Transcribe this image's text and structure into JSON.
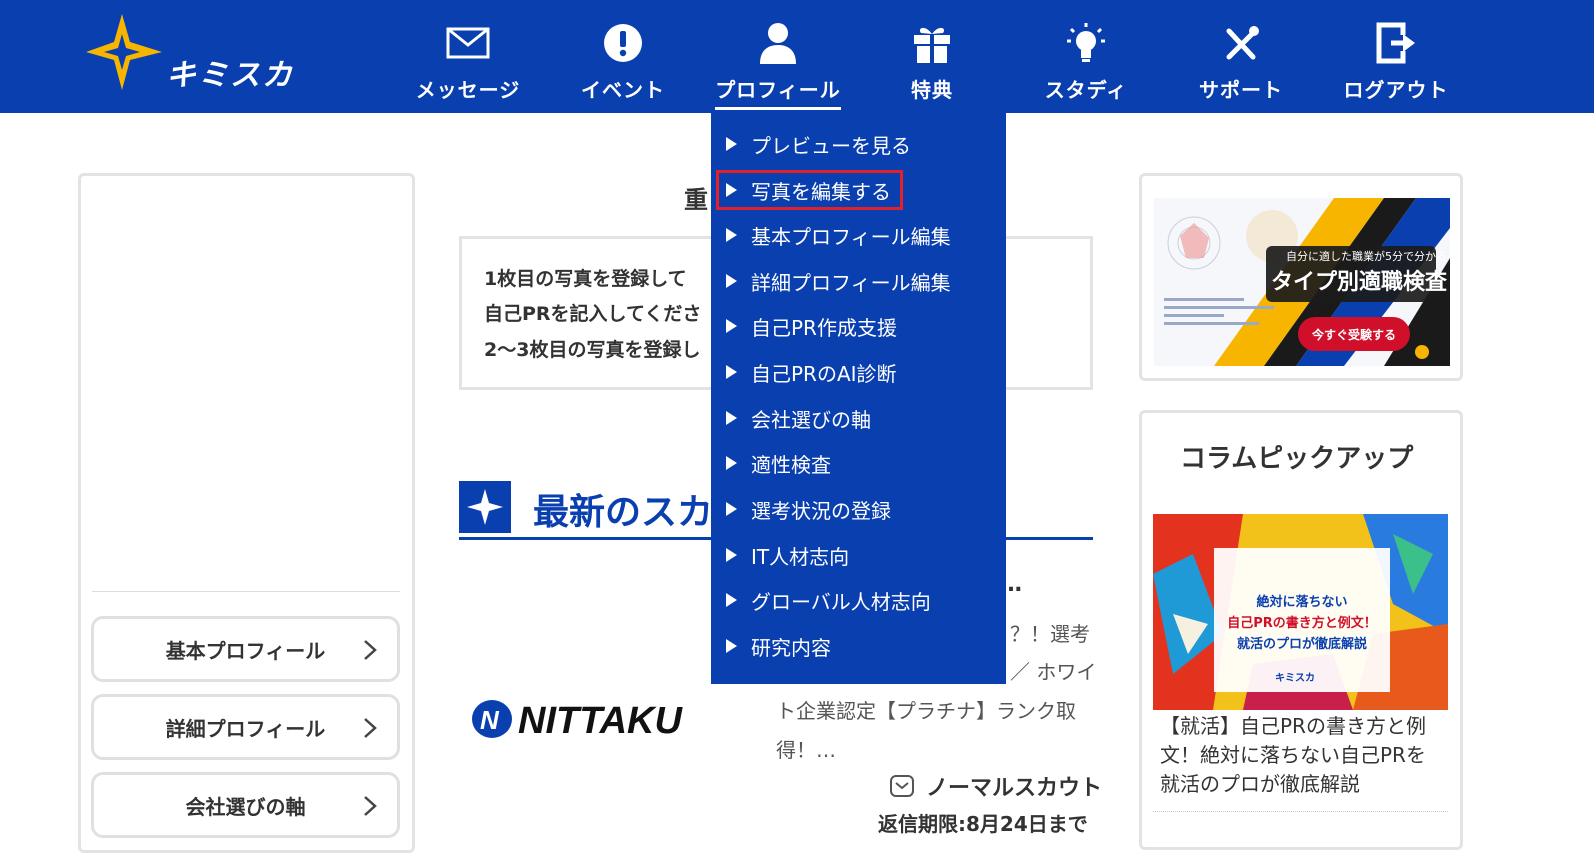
{
  "brand": {
    "name": "キミスカ"
  },
  "nav": [
    {
      "key": "message",
      "label": "メッセージ",
      "icon": "envelope-icon"
    },
    {
      "key": "event",
      "label": "イベント",
      "icon": "exclamation-icon"
    },
    {
      "key": "profile",
      "label": "プロフィール",
      "icon": "user-icon",
      "active": true
    },
    {
      "key": "benefit",
      "label": "特典",
      "icon": "gift-icon"
    },
    {
      "key": "study",
      "label": "スタディ",
      "icon": "lightbulb-icon"
    },
    {
      "key": "support",
      "label": "サポート",
      "icon": "tools-icon"
    },
    {
      "key": "logout",
      "label": "ログアウト",
      "icon": "logout-icon"
    }
  ],
  "dropdown": {
    "items": [
      "プレビューを見る",
      "写真を編集する",
      "基本プロフィール編集",
      "詳細プロフィール編集",
      "自己PR作成支援",
      "自己PRのAI診断",
      "会社選びの軸",
      "適性検査",
      "選考状況の登録",
      "IT人材志向",
      "グローバル人材志向",
      "研究内容"
    ],
    "highlighted_index": 1
  },
  "sidebar": {
    "buttons": [
      "基本プロフィール",
      "詳細プロフィール",
      "会社選びの軸"
    ]
  },
  "main": {
    "important_title": "重",
    "notice_lines": [
      "1枚目の写真を登録して",
      "自己PRを記入してくださ",
      "2〜3枚目の写真を登録し"
    ],
    "section_title": "最新のスカ",
    "scout": {
      "company_logo_text": "NITTAKU",
      "title_fragment": "…",
      "text_lines": [
        "？！選考",
        "／ ホワイ",
        "ト企業認定【プラチナ】ランク取",
        "得！…"
      ],
      "type": "ノーマルスカウト",
      "deadline": "返信期限:8月24日まで"
    }
  },
  "right": {
    "ad": {
      "subtitle": "自分に適した職業が5分で分かる",
      "title": "タイプ別適職検査",
      "cta": "今すぐ受験する"
    },
    "column": {
      "heading": "コラムピックアップ",
      "image_lines": [
        "絶対に落ちない",
        "自己PRの書き方と例文！",
        "就活のプロが徹底解説"
      ],
      "image_brand": "キミスカ",
      "text_lines": [
        "【就活】自己PRの書き方と例",
        "文！絶対に落ちない自己PRを",
        "就活のプロが徹底解説"
      ]
    }
  },
  "colors": {
    "brand_blue": "#0a3fb0",
    "accent_yellow": "#f7b500",
    "highlight_red": "#e0202a"
  }
}
